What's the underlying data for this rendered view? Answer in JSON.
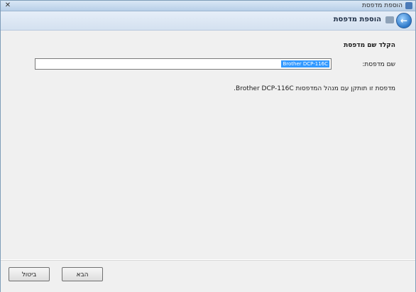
{
  "window": {
    "title": "הוספת מדפסת",
    "close_symbol": "✕"
  },
  "nav": {
    "title": "הוספת מדפסת",
    "back_symbol": "←"
  },
  "content": {
    "heading": "הקלד שם מדפסת",
    "name_label": "שם מדפסת:",
    "name_value": "Brother DCP-116C",
    "info_text": "מדפסת זו תותקן עם מנהל המדפסות Brother DCP-116C."
  },
  "footer": {
    "cancel_label": "ביטול",
    "next_label": "הבא"
  },
  "colors": {
    "selection": "#3399ff",
    "title_bar": "#c8dcf0",
    "back_button": "#2d78c8"
  }
}
